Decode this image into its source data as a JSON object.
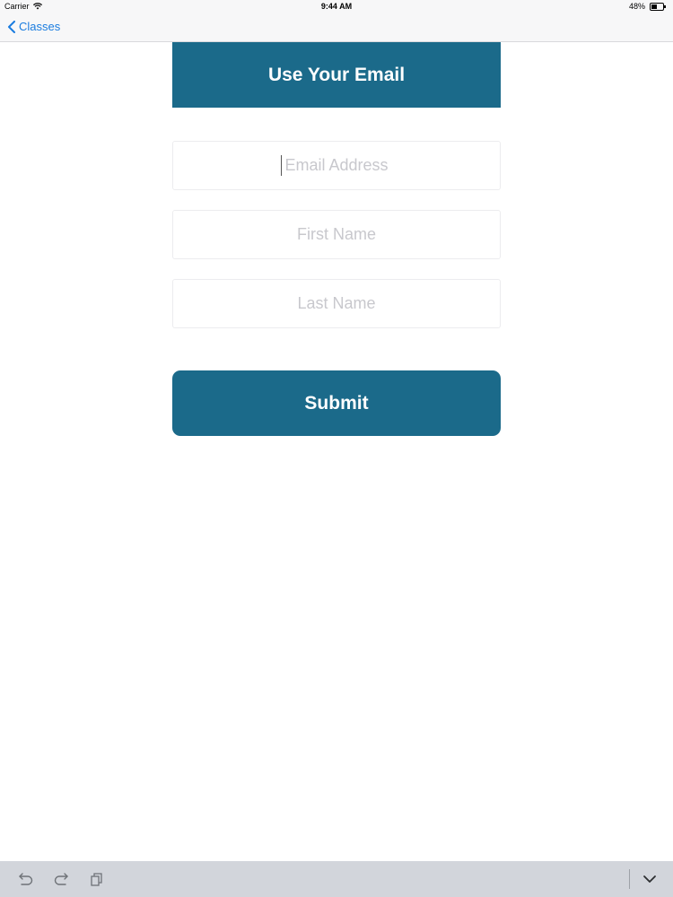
{
  "status_bar": {
    "carrier": "Carrier",
    "time": "9:44 AM",
    "battery": "48%",
    "battery_level": 0.48
  },
  "nav": {
    "back_label": "Classes",
    "accent_color": "#1a7cdf"
  },
  "header": {
    "title": "Use Your Email",
    "color": "#1b6a8a"
  },
  "form": {
    "email_placeholder": "Email Address",
    "email_value": "",
    "first_name_placeholder": "First Name",
    "first_name_value": "",
    "last_name_placeholder": "Last Name",
    "last_name_value": "",
    "submit_label": "Submit"
  },
  "keyboard_toolbar": {
    "icons": [
      "undo-icon",
      "redo-icon",
      "paste-icon",
      "keyboard-dismiss-icon"
    ]
  }
}
